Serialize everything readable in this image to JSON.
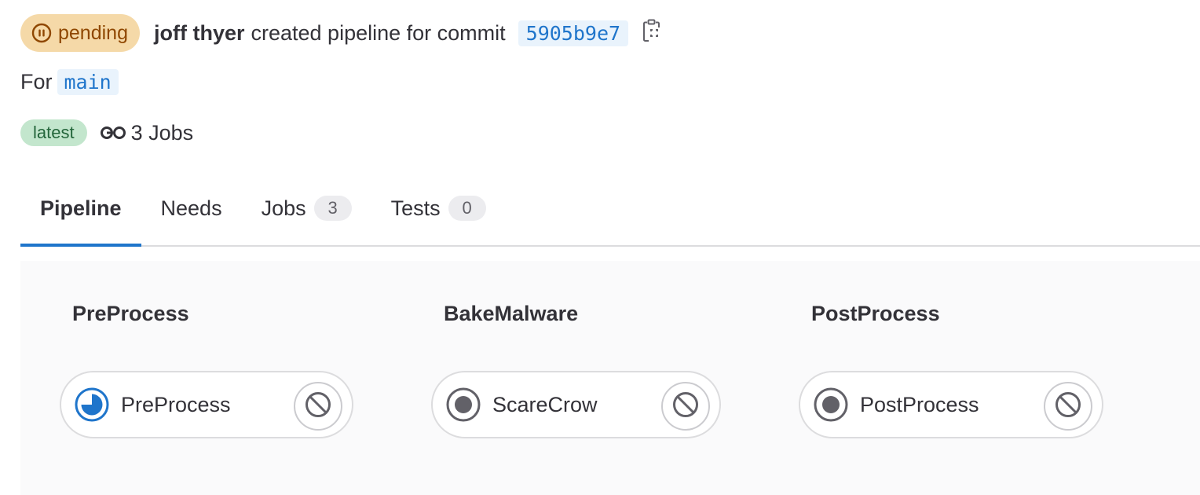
{
  "header": {
    "status_label": "pending",
    "author": "joff thyer",
    "created_text": "created pipeline for commit",
    "commit_sha": "5905b9e7"
  },
  "ref": {
    "prefix": "For",
    "branch": "main"
  },
  "meta": {
    "latest_label": "latest",
    "jobs_label": "3 Jobs"
  },
  "tabs": [
    {
      "label": "Pipeline",
      "active": true
    },
    {
      "label": "Needs"
    },
    {
      "label": "Jobs",
      "count": "3"
    },
    {
      "label": "Tests",
      "count": "0"
    }
  ],
  "stages": [
    {
      "title": "PreProcess",
      "job": {
        "name": "PreProcess",
        "status": "running-icon"
      }
    },
    {
      "title": "BakeMalware",
      "job": {
        "name": "ScareCrow",
        "status": "pending-icon"
      }
    },
    {
      "title": "PostProcess",
      "job": {
        "name": "PostProcess",
        "status": "pending-icon"
      }
    }
  ],
  "colors": {
    "pending_bg": "#f5d9a8",
    "pending_fg": "#8f4700",
    "link_blue": "#1f75cb",
    "latest_bg": "#c3e6cd",
    "latest_fg": "#24663b"
  }
}
